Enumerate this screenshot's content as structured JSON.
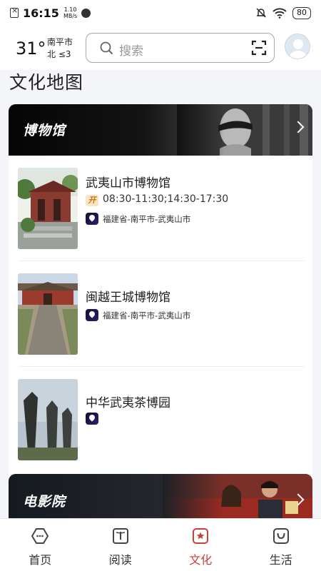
{
  "status_bar": {
    "time": "16:15",
    "net_speed_value": "1.10",
    "net_speed_unit": "MB/s",
    "battery": "80"
  },
  "header": {
    "weather": {
      "temperature": "31°",
      "city": "南平市",
      "wind": "北  ≤3"
    },
    "search": {
      "placeholder": "搜索"
    }
  },
  "page": {
    "title": "文化地图"
  },
  "sections": [
    {
      "title": "博物馆",
      "venues": [
        {
          "name": "武夷山市博物馆",
          "hours_badge": "开",
          "hours": "08:30-11:30;14:30-17:30",
          "location": "福建省-南平市-武夷山市"
        },
        {
          "name": "闽越王城博物馆",
          "location": "福建省-南平市-武夷山市"
        },
        {
          "name": "中华武夷茶博园",
          "location": ""
        }
      ]
    },
    {
      "title": "电影院"
    }
  ],
  "bottom_nav": {
    "items": [
      {
        "label": "首页",
        "icon": "home-icon"
      },
      {
        "label": "阅读",
        "icon": "book-icon"
      },
      {
        "label": "文化",
        "icon": "culture-icon",
        "active": true
      },
      {
        "label": "生活",
        "icon": "life-bag-icon"
      }
    ]
  },
  "colors": {
    "accent": "#c8423a",
    "page_background": "#f4f5f8",
    "hours_badge": "#fbe4c3"
  }
}
